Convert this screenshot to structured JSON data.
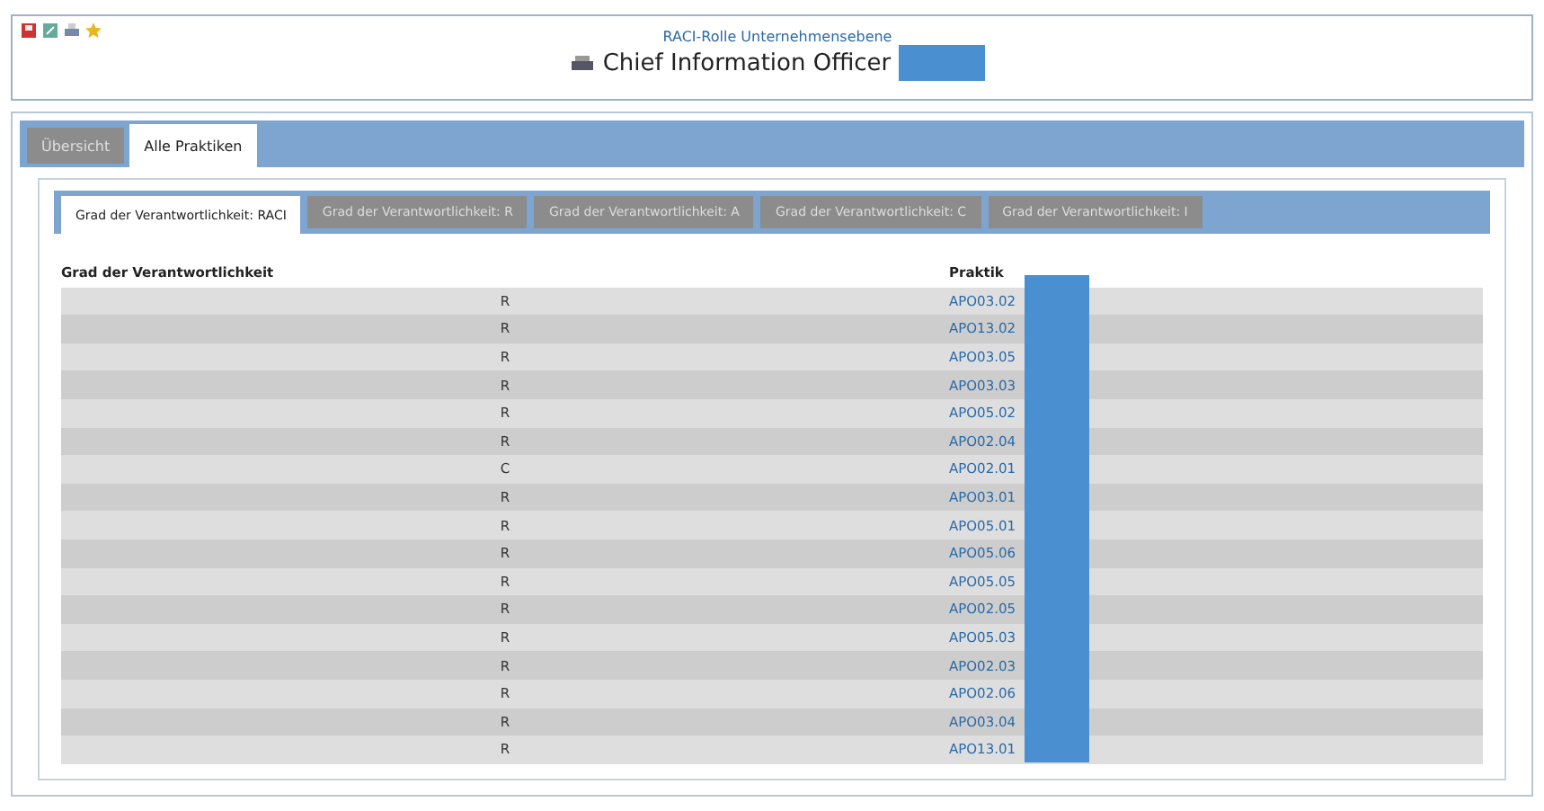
{
  "header": {
    "subtitle": "RACI-Rolle Unternehmensebene",
    "title": "Chief Information Officer"
  },
  "tabs": [
    {
      "label": "Übersicht",
      "selected": false
    },
    {
      "label": "Alle Praktiken",
      "selected": true
    }
  ],
  "inner_tabs": [
    {
      "label": "Grad der Verantwortlichkeit: RACI",
      "selected": true
    },
    {
      "label": "Grad der Verantwortlichkeit: R",
      "selected": false
    },
    {
      "label": "Grad der Verantwortlichkeit: A",
      "selected": false
    },
    {
      "label": "Grad der Verantwortlichkeit: C",
      "selected": false
    },
    {
      "label": "Grad der Verantwortlichkeit: I",
      "selected": false
    }
  ],
  "table": {
    "columns": [
      "Grad der Verantwortlichkeit",
      "Praktik"
    ],
    "rows": [
      [
        "R",
        "APO03.02"
      ],
      [
        "R",
        "APO13.02"
      ],
      [
        "R",
        "APO03.05"
      ],
      [
        "R",
        "APO03.03"
      ],
      [
        "R",
        "APO05.02"
      ],
      [
        "R",
        "APO02.04"
      ],
      [
        "C",
        "APO02.01"
      ],
      [
        "R",
        "APO03.01"
      ],
      [
        "R",
        "APO05.01"
      ],
      [
        "R",
        "APO05.06"
      ],
      [
        "R",
        "APO05.05"
      ],
      [
        "R",
        "APO02.05"
      ],
      [
        "R",
        "APO05.03"
      ],
      [
        "R",
        "APO02.03"
      ],
      [
        "R",
        "APO02.06"
      ],
      [
        "R",
        "APO03.04"
      ],
      [
        "R",
        "APO13.01"
      ]
    ]
  }
}
